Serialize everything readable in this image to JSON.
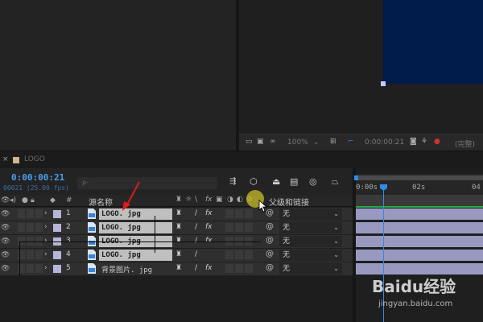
{
  "tabs": {
    "comp_tab": "LOGO"
  },
  "viewer": {
    "zoom": "100%",
    "timecode": "0:00:00:21",
    "quality": "(完整)"
  },
  "timeline": {
    "current_time": "0:00:00:21",
    "frame_info": "00021 (25.00 fps)",
    "search_placeholder": "ρ-",
    "columns": {
      "number": "#",
      "source_name": "源名称",
      "parent": "父级和链接"
    },
    "ruler": {
      "t0": "0:00s",
      "t1": "02s",
      "t2": "04"
    }
  },
  "layers": [
    {
      "number": "1",
      "name": "LOGO. jpg",
      "parent": "无"
    },
    {
      "number": "2",
      "name": "LOGO. jpg",
      "parent": "无"
    },
    {
      "number": "3",
      "name": "LOGO. jpg",
      "parent": "无"
    },
    {
      "number": "4",
      "name": "LOGO. jpg",
      "parent": "无"
    },
    {
      "number": "5",
      "name": "背景图片. jpg",
      "parent": "无"
    }
  ],
  "watermark": {
    "brand": "Baidu经验",
    "url": "jingyan.baidu.com"
  },
  "colors": {
    "accent_blue": "#2d8ceb",
    "comp_bg": "#001a4a",
    "label_lavender": "#b5b5d8",
    "track_lavender": "#9999c0",
    "red_arrow": "#e0191a",
    "green_bar": "#2aa84a"
  }
}
